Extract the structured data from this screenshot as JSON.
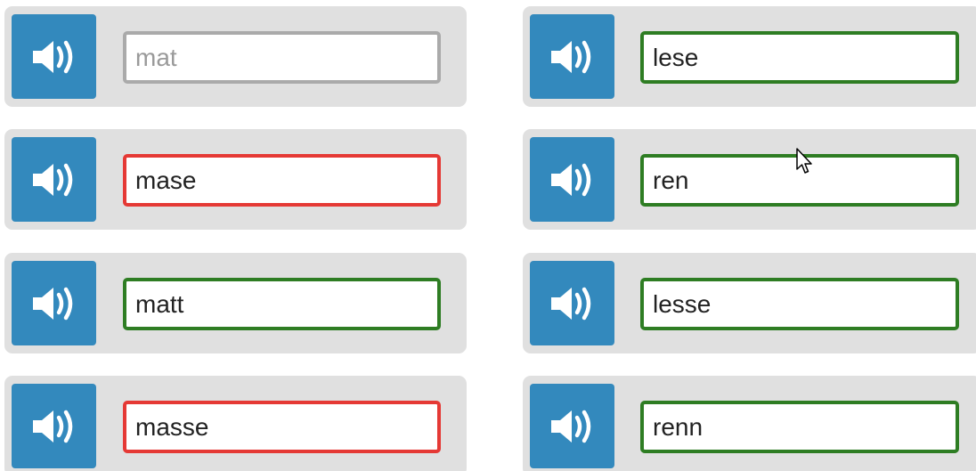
{
  "colors": {
    "card_bg": "#e0e0e0",
    "speaker_button": "#3389bd",
    "border_empty": "#aaaaaa",
    "border_wrong": "#e53935",
    "border_correct": "#2e7d23"
  },
  "speaker_icon": "speaker-volume-icon",
  "items": [
    {
      "value": "",
      "placeholder": "mat",
      "state": "empty"
    },
    {
      "value": "lese",
      "placeholder": "",
      "state": "correct"
    },
    {
      "value": "mase",
      "placeholder": "",
      "state": "wrong"
    },
    {
      "value": "ren",
      "placeholder": "",
      "state": "correct"
    },
    {
      "value": "matt",
      "placeholder": "",
      "state": "correct"
    },
    {
      "value": "lesse",
      "placeholder": "",
      "state": "correct"
    },
    {
      "value": "masse",
      "placeholder": "",
      "state": "wrong"
    },
    {
      "value": "renn",
      "placeholder": "",
      "state": "correct"
    }
  ]
}
